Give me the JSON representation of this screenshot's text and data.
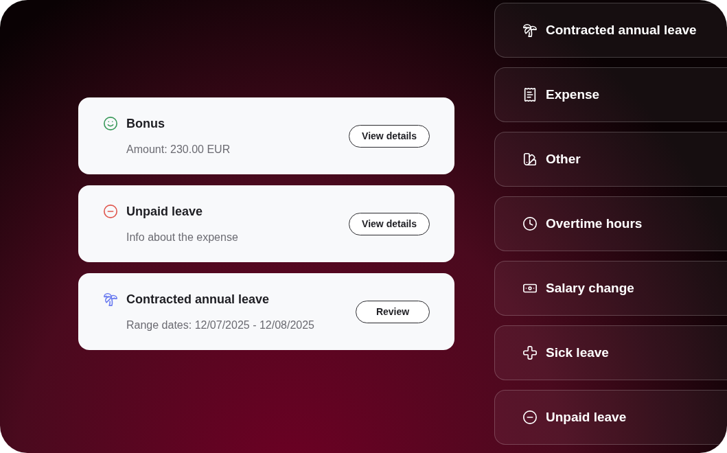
{
  "requests": [
    {
      "kind": "bonus",
      "title": "Bonus",
      "detail": "Amount: 230.00 EUR",
      "action": "View details"
    },
    {
      "kind": "unpaid",
      "title": "Unpaid leave",
      "detail": "Info about the expense",
      "action": "View details"
    },
    {
      "kind": "annual",
      "title": "Contracted annual leave",
      "detail": "Range dates: 12/07/2025 - 12/08/2025",
      "action": "Review"
    }
  ],
  "categories": [
    {
      "kind": "annual",
      "label": "Contracted annual leave"
    },
    {
      "kind": "expense",
      "label": "Expense"
    },
    {
      "kind": "other",
      "label": "Other"
    },
    {
      "kind": "overtime",
      "label": "Overtime hours"
    },
    {
      "kind": "salary",
      "label": "Salary change"
    },
    {
      "kind": "sick",
      "label": "Sick leave"
    },
    {
      "kind": "unpaid",
      "label": "Unpaid leave"
    }
  ]
}
